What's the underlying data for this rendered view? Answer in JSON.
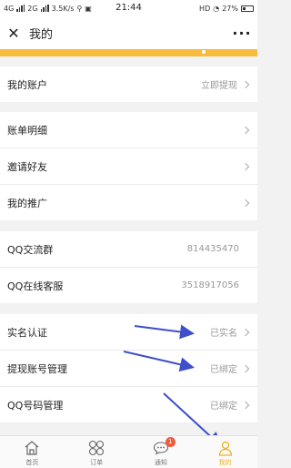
{
  "status_bar": {
    "network_left": "4G",
    "network_right": "2G",
    "speed": "3.5K/s",
    "time": "21:44",
    "hd": "HD",
    "battery": "27%"
  },
  "header": {
    "title": "我的",
    "close_icon": "close-icon",
    "more_icon": "more-icon",
    "more_glyph": "···"
  },
  "banner": {
    "color": "#f8bb3c"
  },
  "rows": [
    {
      "label": "我的账户",
      "value": "立即提现"
    },
    {
      "label": "账单明细",
      "value": ""
    },
    {
      "label": "邀请好友",
      "value": ""
    },
    {
      "label": "我的推广",
      "value": ""
    },
    {
      "label": "QQ交流群",
      "value": "814435470"
    },
    {
      "label": "QQ在线客服",
      "value": "3518917056"
    },
    {
      "label": "实名认证",
      "value": "已实名"
    },
    {
      "label": "提现账号管理",
      "value": "已绑定"
    },
    {
      "label": "QQ号码管理",
      "value": "已绑定"
    }
  ],
  "tabs": [
    {
      "label": "首页",
      "icon": "home-icon"
    },
    {
      "label": "订单",
      "icon": "order-icon"
    },
    {
      "label": "通知",
      "icon": "message-icon",
      "badge": "1"
    },
    {
      "label": "我的",
      "icon": "user-icon",
      "active": true
    }
  ],
  "colors": {
    "accent": "#f0b020",
    "arrow": "#3e4fc9",
    "badge": "#f15a3c"
  }
}
